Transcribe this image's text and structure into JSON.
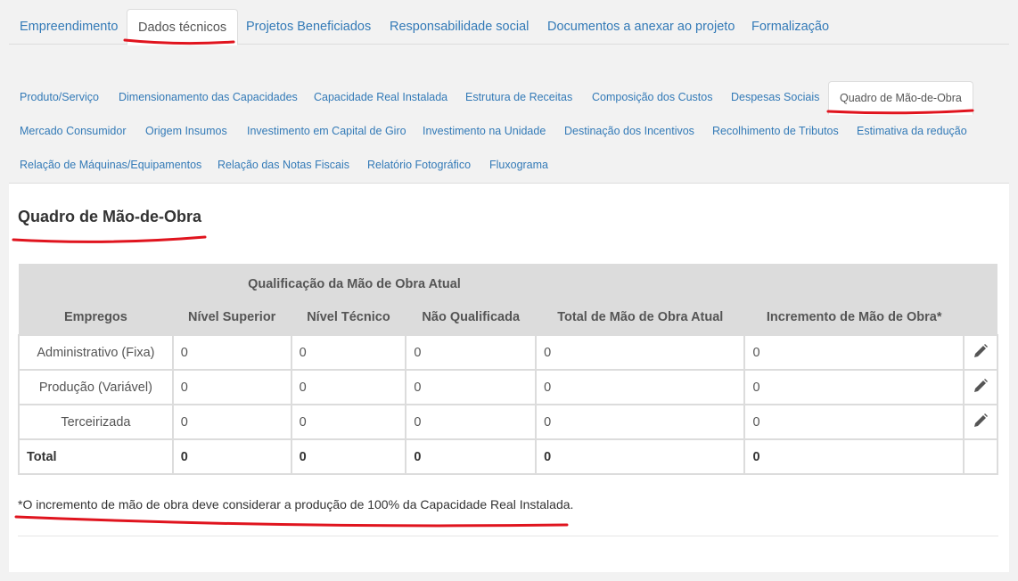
{
  "top_tabs": [
    {
      "label": "Empreendimento"
    },
    {
      "label": "Dados técnicos"
    },
    {
      "label": "Projetos Beneficiados"
    },
    {
      "label": "Responsabilidade social"
    },
    {
      "label": "Documentos a anexar ao projeto"
    },
    {
      "label": "Formalização"
    }
  ],
  "sub_tabs": [
    {
      "label": "Produto/Serviço"
    },
    {
      "label": "Dimensionamento das Capacidades"
    },
    {
      "label": "Capacidade Real Instalada"
    },
    {
      "label": "Estrutura de Receitas"
    },
    {
      "label": "Composição dos Custos"
    },
    {
      "label": "Despesas Sociais"
    },
    {
      "label": "Quadro de Mão-de-Obra"
    },
    {
      "label": "Mercado Consumidor"
    },
    {
      "label": "Origem Insumos"
    },
    {
      "label": "Investimento em Capital de Giro"
    },
    {
      "label": "Investimento na Unidade"
    },
    {
      "label": "Destinação dos Incentivos"
    },
    {
      "label": "Recolhimento de Tributos"
    },
    {
      "label": "Estimativa da redução"
    },
    {
      "label": "Relação de Máquinas/Equipamentos"
    },
    {
      "label": "Relação das Notas Fiscais"
    },
    {
      "label": "Relatório Fotográfico"
    },
    {
      "label": "Fluxograma"
    }
  ],
  "section": {
    "title": "Quadro de Mão-de-Obra"
  },
  "table": {
    "group_header": "Qualificação da Mão de Obra Atual",
    "columns": [
      "Empregos",
      "Nível Superior",
      "Nível Técnico",
      "Não Qualificada",
      "Total de Mão de Obra Atual",
      "Incremento de Mão de Obra*"
    ],
    "rows": [
      {
        "label": "Administrativo (Fixa)",
        "values": [
          "0",
          "0",
          "0",
          "0",
          "0"
        ]
      },
      {
        "label": "Produção (Variável)",
        "values": [
          "0",
          "0",
          "0",
          "0",
          "0"
        ]
      },
      {
        "label": "Terceirizada",
        "values": [
          "0",
          "0",
          "0",
          "0",
          "0"
        ]
      }
    ],
    "total": {
      "label": "Total",
      "values": [
        "0",
        "0",
        "0",
        "0",
        "0"
      ]
    }
  },
  "footnote": "*O incremento de mão de obra deve considerar a produção de 100% da Capacidade Real Instalada.",
  "icons": {
    "edit": "pencil-icon"
  },
  "colors": {
    "link": "#337ab7",
    "header_bg": "#dcdcdc",
    "annotation": "#e0141e"
  }
}
